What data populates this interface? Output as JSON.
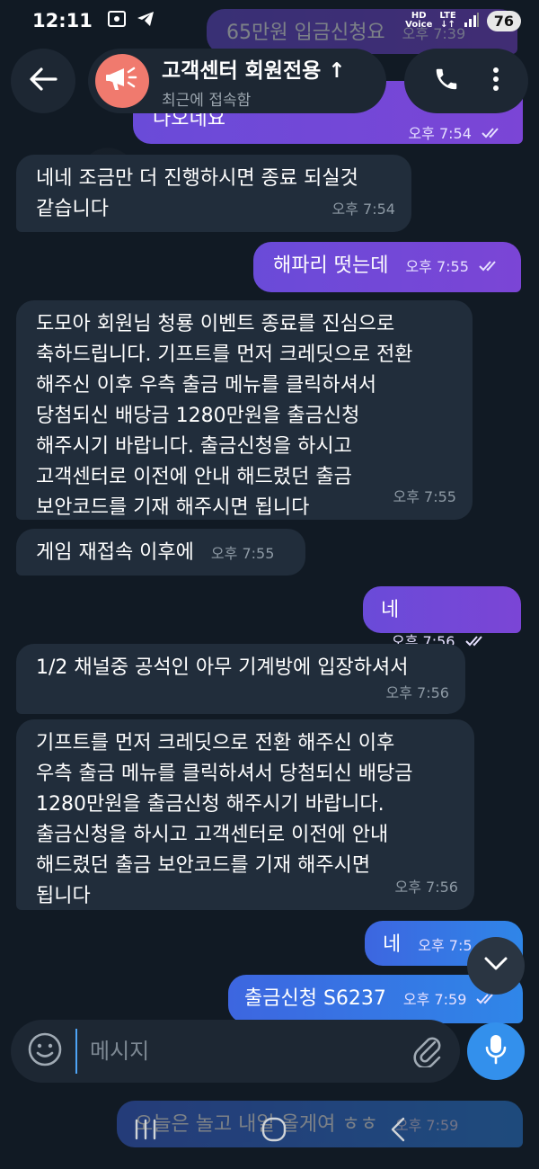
{
  "status_bar": {
    "time": "12:11",
    "hd_label": "HD",
    "voice_label": "Voice",
    "lte_label": "LTE",
    "battery": "76"
  },
  "header": {
    "title": "고객센터 회원전용 ↑",
    "status": "최근에 접속함"
  },
  "messages": [
    {
      "id": "m0",
      "dir": "out",
      "text": "65만원 입금신청요",
      "time": "오후 7:39",
      "faded": true
    },
    {
      "id": "m1",
      "dir": "out",
      "text": "나오네요",
      "time": "오후 7:54"
    },
    {
      "id": "m2",
      "dir": "in",
      "text": "네네 조금만 더 진행하시면 종료 되실것\n같습니다",
      "time": "오후 7:54"
    },
    {
      "id": "m3",
      "dir": "out",
      "text": "해파리 떳는데",
      "time": "오후 7:55"
    },
    {
      "id": "m4",
      "dir": "in",
      "text": "도모아 회원님 청룡 이벤트 종료를 진심으로\n축하드립니다. 기프트를 먼저 크레딧으로 전환\n해주신 이후 우측 출금 메뉴를 클릭하셔서\n당첨되신 배당금 1280만원을 출금신청\n해주시기 바랍니다. 출금신청을 하시고\n고객센터로 이전에 안내 해드렸던 출금\n보안코드를 기재 해주시면 됩니다",
      "time": "오후 7:55"
    },
    {
      "id": "m5",
      "dir": "in",
      "text": "게임 재접속 이후에",
      "time": "오후 7:55"
    },
    {
      "id": "m6",
      "dir": "out",
      "text": "네",
      "time": "오후 7:56"
    },
    {
      "id": "m7",
      "dir": "in",
      "text": "1/2 채널중 공석인 아무 기계방에 입장하셔서",
      "time": "오후 7:56"
    },
    {
      "id": "m8",
      "dir": "in",
      "text": "기프트를 먼저 크레딧으로 전환 해주신 이후\n우측 출금 메뉴를 클릭하셔서 당첨되신 배당금\n1280만원을 출금신청 해주시기 바랍니다.\n출금신청을 하시고 고객센터로 이전에 안내\n해드렸던 출금 보안코드를 기재 해주시면\n됩니다",
      "time": "오후 7:56"
    },
    {
      "id": "m9",
      "dir": "out",
      "text": "네",
      "time": "오후 7:5"
    },
    {
      "id": "m10",
      "dir": "out",
      "text": "출금신청 S6237",
      "time": "오후 7:59"
    },
    {
      "id": "m11",
      "dir": "out",
      "text": "오늘은 놀고 내일 올게여 ㅎㅎ",
      "time": "오후 7:59",
      "faded": true
    }
  ],
  "input": {
    "placeholder": "메시지"
  },
  "colors": {
    "background": "#111a24",
    "incoming_bubble": "#212d3b",
    "outgoing_purple": "#7b45d6",
    "outgoing_blue": "#2f86e8",
    "accent": "#3390ec",
    "avatar": "#f07a6e"
  },
  "icons": {
    "back": "arrow-left-icon",
    "avatar": "megaphone-icon",
    "call": "phone-icon",
    "menu": "more-vertical-icon",
    "scroll": "chevron-down-icon",
    "emoji": "smiley-icon",
    "attach": "paperclip-icon",
    "mic": "microphone-icon",
    "read": "double-check-icon"
  }
}
